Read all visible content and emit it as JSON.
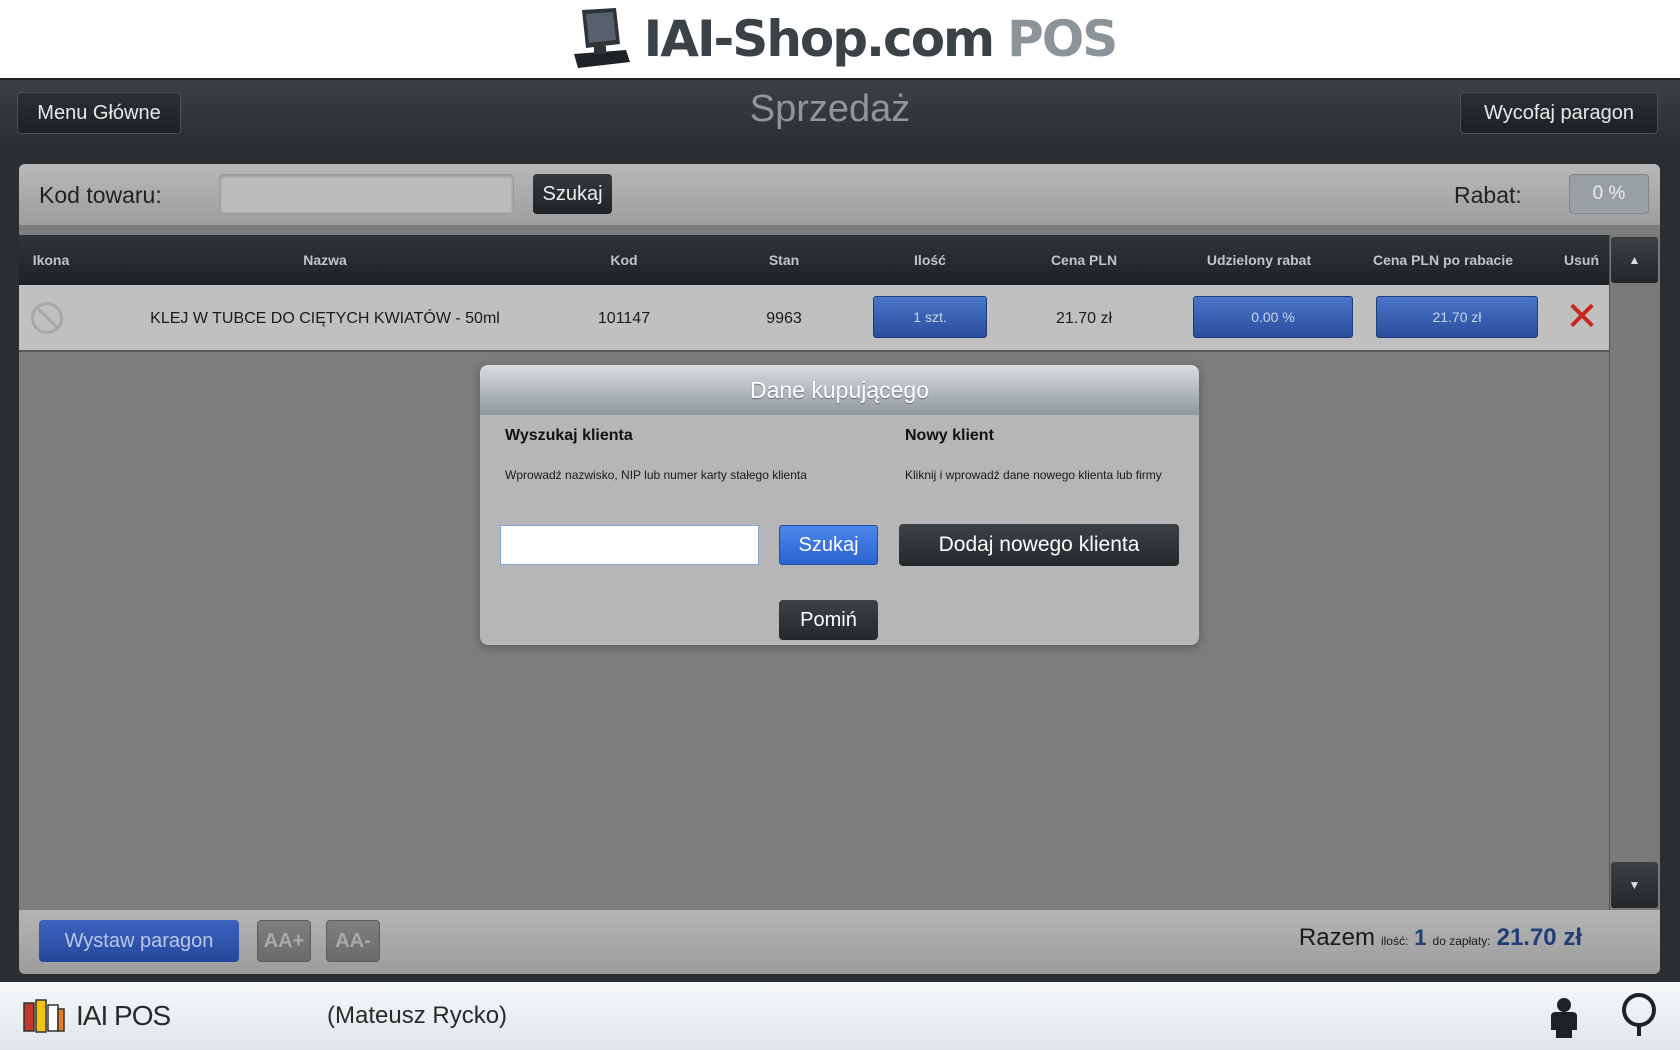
{
  "header": {
    "logo_main": "IAI-Shop.com",
    "logo_pos": "POS"
  },
  "nav": {
    "menu_label": "Menu Główne",
    "title": "Sprzedaż",
    "undo_label": "Wycofaj paragon"
  },
  "search": {
    "code_label": "Kod towaru:",
    "code_value": "",
    "search_label": "Szukaj",
    "discount_label": "Rabat:",
    "discount_value": "0 %"
  },
  "table": {
    "columns": [
      "Ikona",
      "Nazwa",
      "Kod",
      "Stan",
      "Ilość",
      "Cena PLN",
      "Udzielony rabat",
      "Cena PLN po rabacie",
      "Usuń"
    ],
    "rows": [
      {
        "name": "KLEJ W TUBCE DO CIĘTYCH KWIATÓW - 50ml",
        "code": "101147",
        "stock": "9963",
        "qty": "1 szt.",
        "price": "21.70 zł",
        "discount": "0.00 %",
        "price_after": "21.70 zł"
      }
    ]
  },
  "footer": {
    "issue_label": "Wystaw paragon",
    "font_plus": "AA+",
    "font_minus": "AA-",
    "total_label": "Razem",
    "qty_label": "ilość:",
    "qty_value": "1",
    "pay_label": "do zapłaty:",
    "pay_value": "21.70 zł"
  },
  "modal": {
    "title": "Dane kupującego",
    "search_heading": "Wyszukaj klienta",
    "search_desc": "Wprowadź nazwisko, NIP lub numer karty stałego klienta",
    "search_value": "",
    "search_button": "Szukaj",
    "new_heading": "Nowy klient",
    "new_desc": "Kliknij i wprowadź dane nowego klienta lub firmy",
    "add_button": "Dodaj nowego klienta",
    "skip_button": "Pomiń"
  },
  "bottom": {
    "app_name": "IAI POS",
    "user": "(Mateusz Rycko)"
  },
  "colors": {
    "accent_blue": "#2a63d0",
    "delete_red": "#c9241d",
    "dark_button": "#23282a"
  },
  "icons": {
    "pos_terminal": "pos-terminal-icon",
    "no_image": "no-image-icon",
    "delete": "delete-x-icon",
    "scroll_up": "scroll-up-icon",
    "scroll_down": "scroll-down-icon",
    "user": "user-icon",
    "help": "help-icon"
  }
}
